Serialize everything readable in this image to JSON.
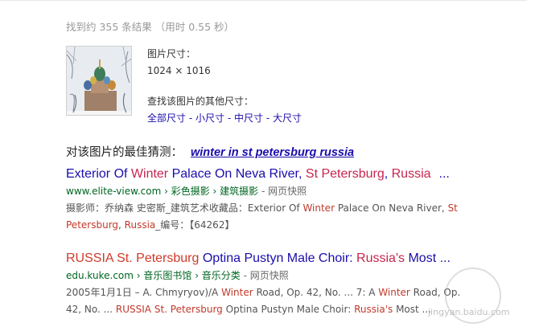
{
  "stats": "找到约 355 条结果 （用时 0.55 秒）",
  "image_info": {
    "size_label": "图片尺寸：",
    "size_value": "1024 × 1016",
    "other_sizes_label": "查找该图片的其他尺寸：",
    "sizes": [
      "全部尺寸",
      "小尺寸",
      "中尺寸",
      "大尺寸"
    ],
    "separator": " - "
  },
  "best_guess": {
    "label": "对该图片的最佳猜测：",
    "query": "winter in st petersburg russia"
  },
  "results": [
    {
      "title_parts": [
        "Exterior Of ",
        "Winter",
        " Palace On Neva River, ",
        "St Petersburg",
        ", ",
        "Russia"
      ],
      "more": "...",
      "url": "www.elite-view.com › 彩色摄影 › 建筑摄影",
      "cache": " - 网页快照",
      "snippet_parts": [
        "摄影师：乔纳森 史密斯_建筑艺术收藏品：Exterior Of ",
        "Winter",
        " Palace On Neva River, ",
        "St Petersburg",
        ", ",
        "Russia",
        "_编号：【64262】"
      ]
    },
    {
      "title_parts": [
        "RUSSIA St. Petersburg",
        " Optina Pustyn Male Choir: ",
        "Russia's",
        " Most ..."
      ],
      "url": "edu.kuke.com › 音乐图书馆 › 音乐分类",
      "cache": " - 网页快照",
      "snippet_parts": [
        "2005年1月1日 – A. Chmyryov)/A ",
        "Winter",
        " Road, Op. 42, No. ... 7: A ",
        "Winter",
        " Road, Op. 42, No. ... ",
        "RUSSIA St. Petersburg",
        " Optina Pustyn Male Choir: ",
        "Russia's",
        " Most ..."
      ]
    }
  ],
  "watermark": "jingyan.baidu.com",
  "colors": {
    "link": "#1a0dab",
    "url": "#006621",
    "highlight": "#c7254e"
  }
}
